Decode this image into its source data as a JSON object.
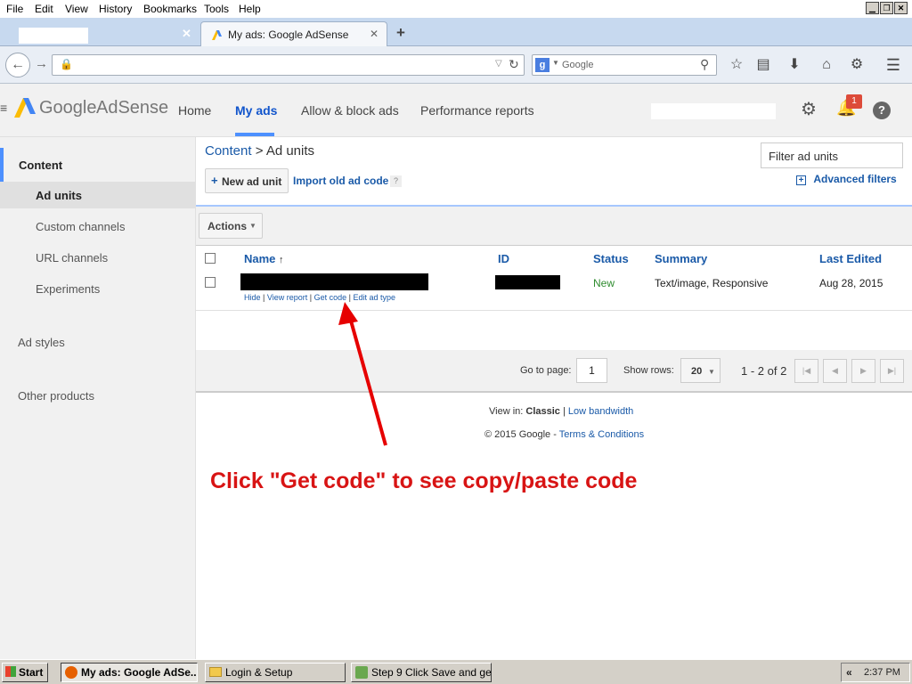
{
  "menu": [
    "File",
    "Edit",
    "View",
    "History",
    "Bookmarks",
    "Tools",
    "Help"
  ],
  "tabs": [
    {
      "label": ""
    },
    {
      "label": "My ads: Google AdSense"
    }
  ],
  "search": {
    "placeholder": "Google"
  },
  "adsense": {
    "logo_google": "Google",
    "logo_adsense": "AdSense",
    "nav": [
      "Home",
      "My ads",
      "Allow & block ads",
      "Performance reports"
    ],
    "notification_count": "1"
  },
  "sidebar": {
    "items": [
      "Content",
      "Ad units",
      "Custom channels",
      "URL channels",
      "Experiments",
      "Ad styles",
      "Other products"
    ]
  },
  "breadcrumb": {
    "parent": "Content",
    "separator": ">",
    "current": "Ad units"
  },
  "filter": {
    "placeholder": "Filter ad units",
    "advanced": "Advanced filters"
  },
  "buttons": {
    "new_ad_unit": "New ad unit",
    "import": "Import old ad code",
    "help": "?",
    "actions": "Actions"
  },
  "table": {
    "headers": [
      "Name",
      "ID",
      "Status",
      "Summary",
      "Last Edited"
    ],
    "rows": [
      {
        "status": "New",
        "summary": "Text/image, Responsive",
        "last_edited": "Aug 28, 2015",
        "actions": [
          "Hide",
          "View report",
          "Get code",
          "Edit ad type"
        ]
      }
    ]
  },
  "pager": {
    "goto_label": "Go to page:",
    "page": "1",
    "rows_label": "Show rows:",
    "rows": "20",
    "range": "1 - 2 of 2"
  },
  "footer": {
    "view_in": "View in:",
    "classic": "Classic",
    "low_bandwidth": "Low bandwidth",
    "copyright": "© 2015 Google",
    "terms": "Terms & Conditions"
  },
  "annotation": "Click \"Get code\" to see copy/paste code",
  "taskbar": {
    "start": "Start",
    "items": [
      "My ads: Google AdSe...",
      "Login & Setup",
      "Step 9 Click Save and ge..."
    ],
    "clock": "2:37 PM"
  },
  "colors": {
    "accent": "#1155cc",
    "annotation": "#e60000",
    "status_new": "#2e8b2e"
  }
}
